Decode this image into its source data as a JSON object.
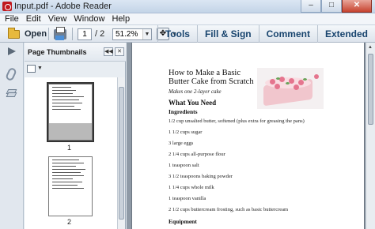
{
  "window": {
    "title": "Input.pdf - Adobe Reader",
    "minimize": "–",
    "maximize": "□",
    "close": "✕"
  },
  "menu": [
    "File",
    "Edit",
    "View",
    "Window",
    "Help"
  ],
  "toolbar": {
    "open_label": "Open",
    "page_current": "1",
    "page_total": "/ 2",
    "zoom": "51.2%",
    "right_tabs": [
      "Tools",
      "Fill & Sign",
      "Comment",
      "Extended"
    ]
  },
  "thumbnail_panel": {
    "title": "Page Thumbnails",
    "pages": [
      {
        "label": "1",
        "selected": true
      },
      {
        "label": "2",
        "selected": false
      }
    ]
  },
  "document": {
    "title": "How to Make a Basic Butter Cake from Scratch",
    "subtitle": "Makes one 2-layer cake",
    "section": "What You Need",
    "subsection": "Ingredients",
    "ingredients": [
      "1/2 cup unsalted butter, softened (plus extra for greasing the pans)",
      "1 1/2 cups sugar",
      "3 large eggs",
      "2 1/4 cups all-purpose flour",
      "1 teaspoon salt",
      "3 1/2 teaspoons baking powder",
      "1 1/4 cups whole milk",
      "1 teaspoon vanilla",
      "2 1/2 cups buttercream frosting, such as basic buttercream"
    ],
    "equipment_heading": "Equipment"
  },
  "colors": {
    "accent": "#18446e",
    "close_button": "#c7432f",
    "doc_background": "#8f9aa6"
  }
}
